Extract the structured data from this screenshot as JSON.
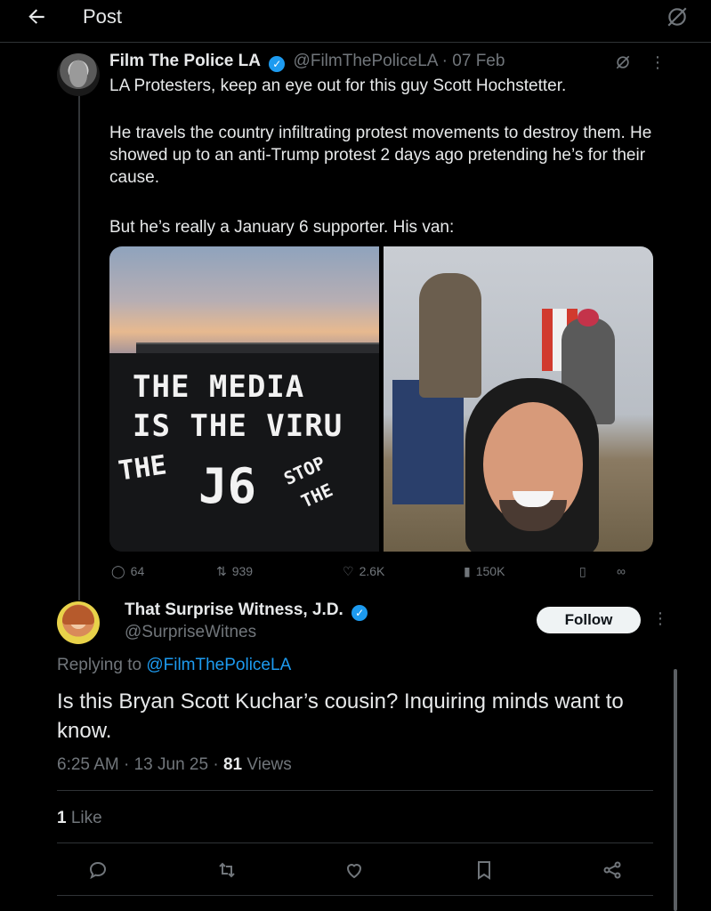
{
  "header": {
    "title": "Post",
    "back_icon": "arrow-left-icon",
    "grok_icon": "grok-icon"
  },
  "quoted": {
    "name": "Film The Police LA",
    "handle": "@FilmThePoliceLA",
    "date": "07 Feb",
    "text_lines": [
      "LA Protesters, keep an eye out for this guy Scott Hochstetter.",
      "He travels the country infiltrating protest movements to destroy them. He showed up to an anti-Trump protest 2 days ago pretending he’s for their cause.",
      "But he’s really a January 6 supporter. His van:"
    ],
    "graffiti": [
      "THE MEDIA",
      "IS THE VIRU",
      "THE",
      "J6",
      "STOP",
      "THE"
    ],
    "stats": {
      "replies": "64",
      "reposts": "939",
      "likes": "2.6K",
      "views": "150K"
    }
  },
  "main": {
    "name": "That Surprise Witness, J.D.",
    "handle": "@SurpriseWitnes",
    "follow_label": "Follow",
    "replying_prefix": "Replying to ",
    "replying_to": "@FilmThePoliceLA",
    "text": "Is this Bryan Scott Kuchar’s cousin? Inquiring minds want to know.",
    "time": "6:25 AM",
    "date": "13 Jun 25",
    "views_count": "81",
    "views_label": "Views",
    "likes_count": "1",
    "likes_label": "Like"
  },
  "colors": {
    "accent": "#1d9bf0",
    "background": "#000000",
    "muted": "#71767b"
  }
}
